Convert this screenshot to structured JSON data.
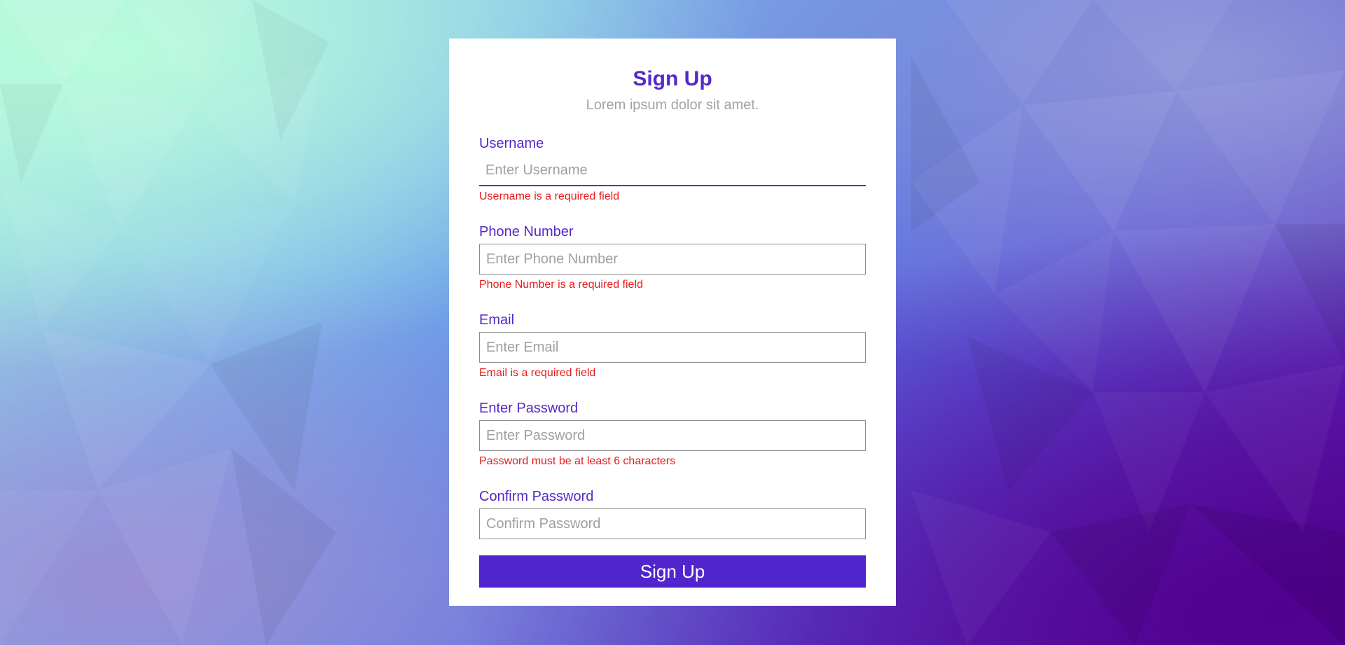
{
  "form": {
    "title": "Sign Up",
    "subtitle": "Lorem ipsum dolor sit amet.",
    "fields": [
      {
        "label": "Username",
        "placeholder": "Enter Username",
        "value": "",
        "error": "Username is a required field"
      },
      {
        "label": "Phone Number",
        "placeholder": "Enter Phone Number",
        "value": "",
        "error": "Phone Number is a required field"
      },
      {
        "label": "Email",
        "placeholder": "Enter Email",
        "value": "",
        "error": "Email is a required field"
      },
      {
        "label": "Enter Password",
        "placeholder": "Enter Password",
        "value": "",
        "error": "Password must be at least 6 characters"
      },
      {
        "label": "Confirm Password",
        "placeholder": "Confirm Password",
        "value": "",
        "error": ""
      }
    ],
    "submit_label": "Sign Up"
  },
  "colors": {
    "accent": "#5428c8",
    "button": "#5125cd",
    "error": "#e81b1b",
    "muted": "#a7a1a6"
  }
}
